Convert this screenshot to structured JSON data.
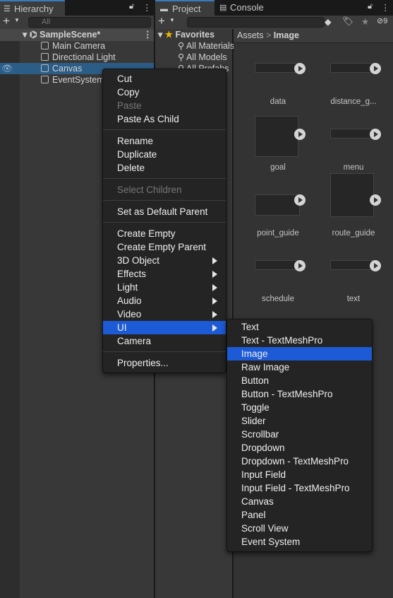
{
  "hierarchy": {
    "title": "Hierarchy",
    "search_placeholder": "All",
    "scene": "SampleScene*",
    "items": [
      "Main Camera",
      "Directional Light",
      "Canvas",
      "EventSystem"
    ],
    "selected": "Canvas"
  },
  "project": {
    "tabs": [
      "Project",
      "Console"
    ],
    "hidden_count": "9",
    "favorites": "Favorites",
    "fav_items": [
      "All Materials",
      "All Models",
      "All Prefabs"
    ],
    "breadcrumb": [
      "Assets",
      "Image"
    ],
    "assets": [
      "data",
      "distance_g...",
      "goal",
      "menu",
      "point_guide",
      "route_guide",
      "schedule",
      "text"
    ]
  },
  "context_menu": {
    "items": [
      {
        "label": "Cut"
      },
      {
        "label": "Copy"
      },
      {
        "label": "Paste",
        "disabled": true
      },
      {
        "label": "Paste As Child"
      },
      {
        "sep": true
      },
      {
        "label": "Rename"
      },
      {
        "label": "Duplicate"
      },
      {
        "label": "Delete"
      },
      {
        "sep": true
      },
      {
        "label": "Select Children",
        "disabled": true
      },
      {
        "sep": true
      },
      {
        "label": "Set as Default Parent"
      },
      {
        "sep": true
      },
      {
        "label": "Create Empty"
      },
      {
        "label": "Create Empty Parent"
      },
      {
        "label": "3D Object",
        "sub": true
      },
      {
        "label": "Effects",
        "sub": true
      },
      {
        "label": "Light",
        "sub": true
      },
      {
        "label": "Audio",
        "sub": true
      },
      {
        "label": "Video",
        "sub": true
      },
      {
        "label": "UI",
        "sub": true,
        "selected": true
      },
      {
        "label": "Camera"
      },
      {
        "sep": true
      },
      {
        "label": "Properties..."
      }
    ]
  },
  "ui_submenu": {
    "items": [
      "Text",
      "Text - TextMeshPro",
      "Image",
      "Raw Image",
      "Button",
      "Button - TextMeshPro",
      "Toggle",
      "Slider",
      "Scrollbar",
      "Dropdown",
      "Dropdown - TextMeshPro",
      "Input Field",
      "Input Field - TextMeshPro",
      "Canvas",
      "Panel",
      "Scroll View",
      "Event System"
    ],
    "selected": "Image"
  },
  "colors": {
    "selection": "#1d5bd6",
    "row_selected": "#2c5d87",
    "tab_accent": "#3a79bb"
  }
}
